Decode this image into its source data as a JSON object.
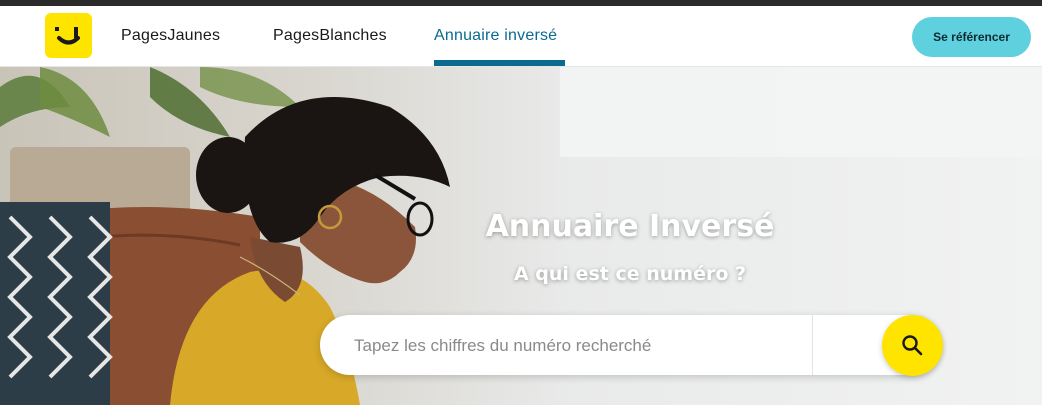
{
  "header": {
    "logo_name": "pagesjaunes-smile-logo",
    "nav": [
      {
        "label": "PagesJaunes"
      },
      {
        "label": "PagesBlanches"
      },
      {
        "label": "Annuaire inversé",
        "active": true
      }
    ],
    "cta_label": "Se référencer"
  },
  "hero": {
    "title": "Annuaire Inversé",
    "subtitle": "A qui est ce numéro ?"
  },
  "search": {
    "placeholder": "Tapez les chiffres du numéro recherché",
    "button_icon": "search-icon"
  },
  "colors": {
    "brand_yellow": "#ffe400",
    "active_blue": "#0a6b8f",
    "cta_teal": "#5fd0de"
  }
}
